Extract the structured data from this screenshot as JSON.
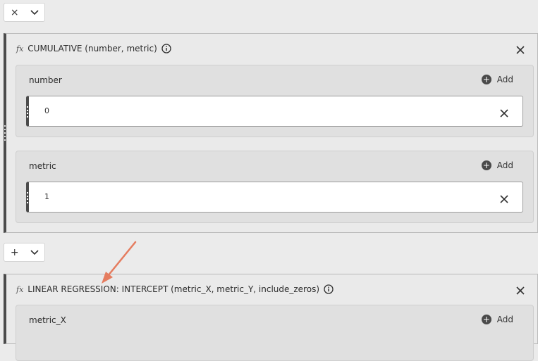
{
  "top_operator": {
    "symbol": "×"
  },
  "cumulative": {
    "title": "CUMULATIVE (number, metric)",
    "params": [
      {
        "label": "number",
        "add_label": "Add",
        "value": "0"
      },
      {
        "label": "metric",
        "add_label": "Add",
        "value": "1"
      }
    ]
  },
  "mid_operator": {
    "symbol": "+"
  },
  "linear": {
    "title": "LINEAR REGRESSION: INTERCEPT (metric_X, metric_Y, include_zeros)",
    "params": [
      {
        "label": "metric_X",
        "add_label": "Add"
      }
    ]
  },
  "annotation": {
    "color": "#e57c5f"
  }
}
